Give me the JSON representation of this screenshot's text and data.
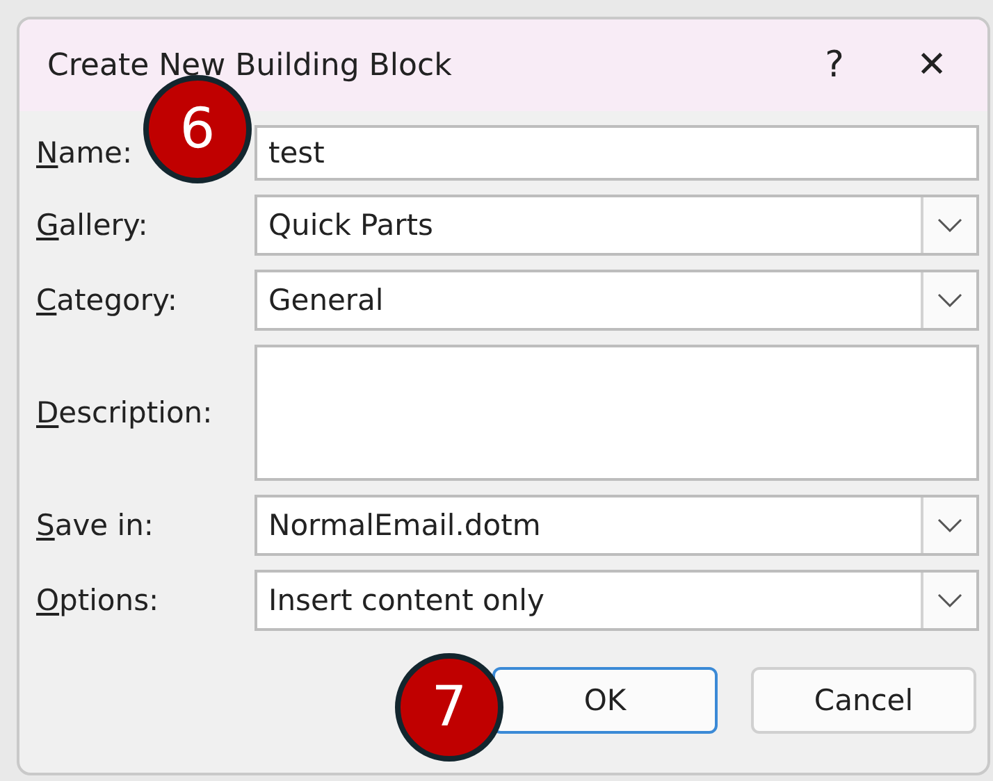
{
  "window": {
    "title": "Create New Building Block",
    "help": "?",
    "close": "✕"
  },
  "fields": [
    {
      "label": "Name:",
      "kind": "text",
      "value": "test"
    },
    {
      "label": "Gallery:",
      "kind": "dropdown",
      "value": "Quick Parts"
    },
    {
      "label": "Category:",
      "kind": "dropdown",
      "value": "General"
    },
    {
      "label": "Description:",
      "kind": "textarea"
    },
    {
      "label": "Save in:",
      "kind": "dropdown",
      "value": "NormalEmail.dotm"
    },
    {
      "label": "Options:",
      "kind": "dropdown",
      "value": "Insert content only"
    }
  ],
  "buttons": [
    {
      "label": "OK",
      "selected": true
    },
    {
      "label": "Cancel",
      "selected": false
    }
  ],
  "callouts": [
    "6",
    "7"
  ]
}
